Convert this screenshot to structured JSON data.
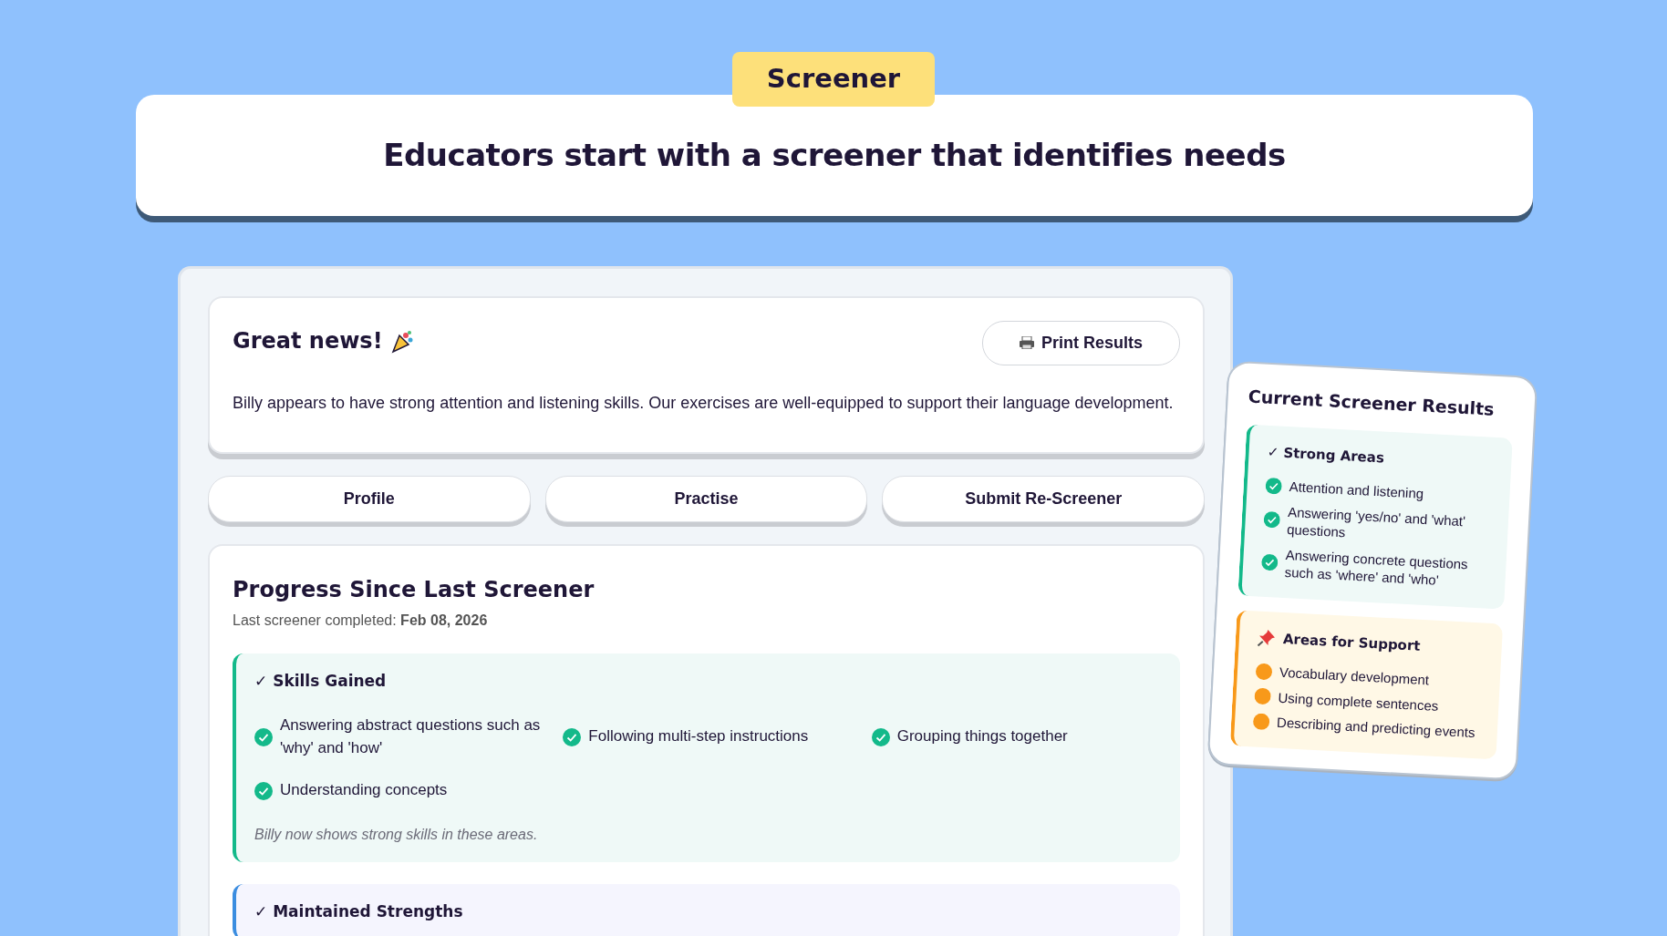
{
  "badge": "Screener",
  "headline": "Educators start with a screener that identifies needs",
  "summary": {
    "title": "Great news!",
    "print_button": "Print Results",
    "message": "Billy appears to have strong attention and listening skills. Our exercises are well-equipped to support their language development."
  },
  "actions": [
    "Profile",
    "Practise",
    "Submit Re-Screener"
  ],
  "progress": {
    "title": "Progress Since Last Screener",
    "last_label": "Last screener completed:",
    "last_date": "Feb 08, 2026",
    "sections": [
      {
        "kind": "gained",
        "title": "✓ Skills Gained",
        "items": [
          "Answering abstract questions such as 'why' and 'how'",
          "Following multi-step instructions",
          "Grouping things together",
          "Understanding concepts"
        ],
        "note": "Billy now shows strong skills in these areas."
      },
      {
        "kind": "maintained",
        "title": "✓ Maintained Strengths"
      }
    ]
  },
  "results": {
    "title": "Current Screener Results",
    "sections": [
      {
        "kind": "strong",
        "title": "✓ Strong Areas",
        "items": [
          "Attention and listening",
          "Answering 'yes/no' and 'what' questions",
          "Answering concrete questions such as 'where' and 'who'"
        ]
      },
      {
        "kind": "support",
        "title": "Areas for Support",
        "items": [
          "Vocabulary development",
          "Using complete sentences",
          "Describing and predicting events"
        ]
      }
    ]
  }
}
